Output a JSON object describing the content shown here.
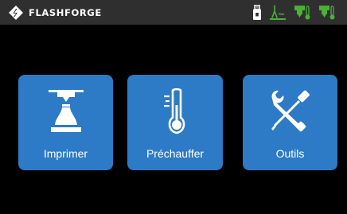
{
  "header": {
    "brand": "FLASHFORGE",
    "logo_icon": "flashforge-logo-icon",
    "status_icons": [
      "usb-drive-icon",
      "print-bed-icon",
      "extruder-left-temp-icon",
      "extruder-right-temp-icon"
    ],
    "status_color": "#4caf3a"
  },
  "menu": {
    "print_label": "Imprimer",
    "print_icon": "printer-nozzle-icon",
    "preheat_label": "Préchauffer",
    "preheat_icon": "thermometer-icon",
    "tools_label": "Outils",
    "tools_icon": "wrench-screwdriver-icon",
    "tile_color": "#2d7ac6"
  }
}
